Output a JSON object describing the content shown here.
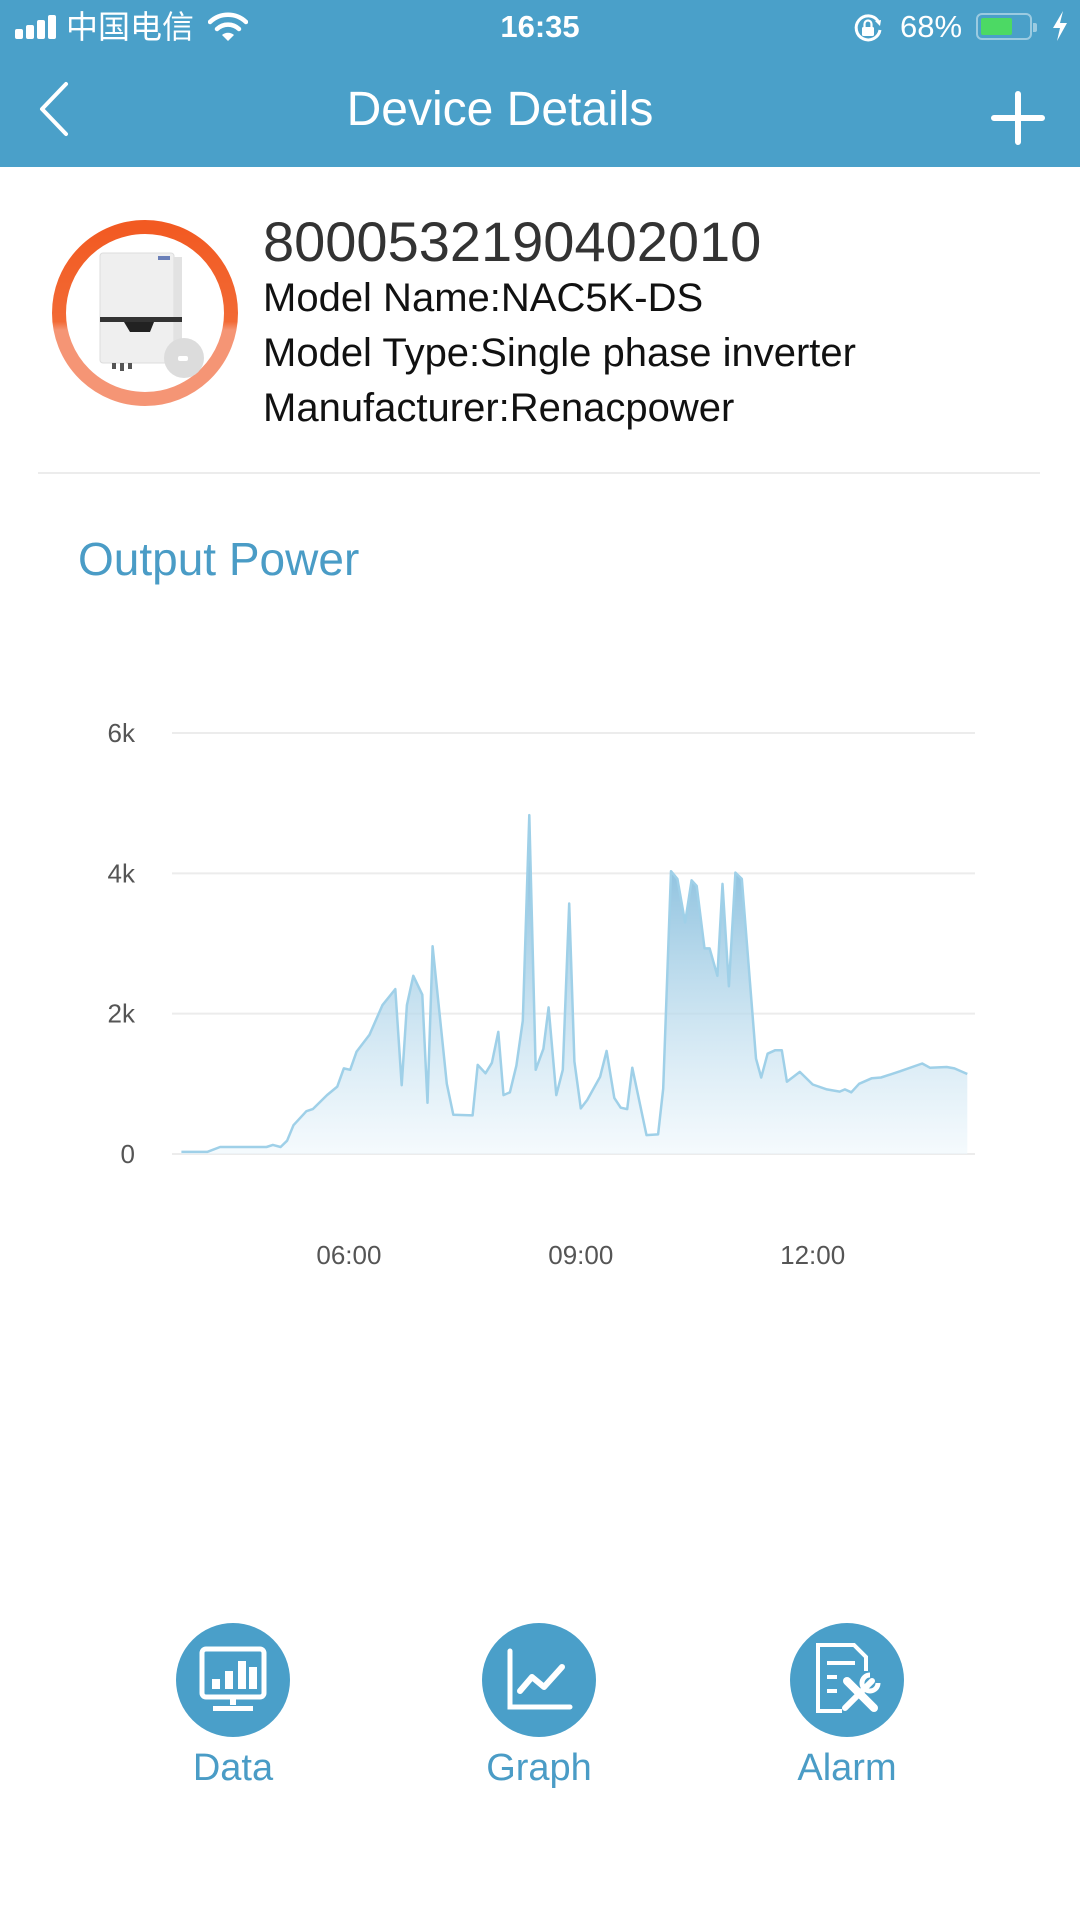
{
  "status_bar": {
    "carrier": "中国电信",
    "time": "16:35",
    "battery_percent_label": "68%",
    "battery_level": 0.68,
    "signal_bars": 4,
    "icons": [
      "signal-icon",
      "wifi-icon",
      "rotation-lock-icon",
      "battery-icon",
      "charging-bolt-icon"
    ]
  },
  "nav": {
    "title": "Device Details",
    "back_icon": "chevron-left-icon",
    "add_icon": "plus-icon"
  },
  "device": {
    "serial": "8000532190402010",
    "model_name": "Model Name:NAC5K-DS",
    "model_type": "Model Type:Single phase inverter",
    "manufacturer": "Manufacturer:Renacpower",
    "ring_colors": {
      "top": "#f25a22",
      "bottom": "#f59575"
    }
  },
  "section": {
    "title": "Output Power"
  },
  "colors": {
    "accent": "#4aa0c9",
    "line": "#9fd0e8",
    "fill_top": "#6fb1d6",
    "fill_bottom": "#eef7fc",
    "grid": "#ececec"
  },
  "chart_data": {
    "type": "area",
    "title": "Output Power",
    "xlabel": "",
    "ylabel": "",
    "xlim": [
      "03:45",
      "14:06"
    ],
    "ylim": [
      0,
      6000
    ],
    "yticks": [
      {
        "value": 0,
        "label": "0"
      },
      {
        "value": 2000,
        "label": "2k"
      },
      {
        "value": 4000,
        "label": "4k"
      },
      {
        "value": 6000,
        "label": "6k"
      }
    ],
    "xticks": [
      {
        "value": "06:00",
        "label": "06:00"
      },
      {
        "value": "09:00",
        "label": "09:00"
      },
      {
        "value": "12:00",
        "label": "12:00"
      }
    ],
    "grid": true,
    "legend": "none",
    "series": [
      {
        "name": "Output Power",
        "points": [
          [
            "03:50",
            30
          ],
          [
            "04:10",
            30
          ],
          [
            "04:20",
            100
          ],
          [
            "04:56",
            100
          ],
          [
            "05:01",
            130
          ],
          [
            "05:07",
            100
          ],
          [
            "05:12",
            190
          ],
          [
            "05:17",
            410
          ],
          [
            "05:27",
            610
          ],
          [
            "05:32",
            640
          ],
          [
            "05:43",
            840
          ],
          [
            "05:51",
            960
          ],
          [
            "05:56",
            1220
          ],
          [
            "06:01",
            1200
          ],
          [
            "06:06",
            1460
          ],
          [
            "06:16",
            1700
          ],
          [
            "06:26",
            2120
          ],
          [
            "06:36",
            2350
          ],
          [
            "06:41",
            980
          ],
          [
            "06:45",
            2120
          ],
          [
            "06:50",
            2540
          ],
          [
            "06:57",
            2270
          ],
          [
            "07:01",
            730
          ],
          [
            "07:05",
            2960
          ],
          [
            "07:16",
            1000
          ],
          [
            "07:21",
            560
          ],
          [
            "07:36",
            550
          ],
          [
            "07:40",
            1270
          ],
          [
            "07:46",
            1150
          ],
          [
            "07:51",
            1300
          ],
          [
            "07:56",
            1740
          ],
          [
            "08:00",
            840
          ],
          [
            "08:05",
            880
          ],
          [
            "08:10",
            1260
          ],
          [
            "08:15",
            1900
          ],
          [
            "08:20",
            4830
          ],
          [
            "08:25",
            1200
          ],
          [
            "08:31",
            1500
          ],
          [
            "08:35",
            2090
          ],
          [
            "08:41",
            840
          ],
          [
            "08:46",
            1200
          ],
          [
            "08:51",
            3570
          ],
          [
            "08:55",
            1320
          ],
          [
            "09:00",
            650
          ],
          [
            "09:05",
            770
          ],
          [
            "09:15",
            1100
          ],
          [
            "09:20",
            1470
          ],
          [
            "09:26",
            800
          ],
          [
            "09:31",
            660
          ],
          [
            "09:36",
            640
          ],
          [
            "09:40",
            1230
          ],
          [
            "09:51",
            270
          ],
          [
            "10:00",
            280
          ],
          [
            "10:04",
            930
          ],
          [
            "10:10",
            4030
          ],
          [
            "10:15",
            3920
          ],
          [
            "10:21",
            3300
          ],
          [
            "10:26",
            3900
          ],
          [
            "10:30",
            3820
          ],
          [
            "10:36",
            2930
          ],
          [
            "10:40",
            2930
          ],
          [
            "10:46",
            2540
          ],
          [
            "10:50",
            3850
          ],
          [
            "10:55",
            2390
          ],
          [
            "11:00",
            4010
          ],
          [
            "11:05",
            3920
          ],
          [
            "11:16",
            1360
          ],
          [
            "11:20",
            1090
          ],
          [
            "11:25",
            1430
          ],
          [
            "11:31",
            1480
          ],
          [
            "11:36",
            1480
          ],
          [
            "11:40",
            1030
          ],
          [
            "11:50",
            1170
          ],
          [
            "12:00",
            990
          ],
          [
            "12:11",
            920
          ],
          [
            "12:21",
            890
          ],
          [
            "12:25",
            920
          ],
          [
            "12:30",
            880
          ],
          [
            "12:36",
            1000
          ],
          [
            "12:46",
            1080
          ],
          [
            "12:53",
            1090
          ],
          [
            "13:08",
            1180
          ],
          [
            "13:25",
            1290
          ],
          [
            "13:31",
            1230
          ],
          [
            "13:44",
            1240
          ],
          [
            "13:50",
            1220
          ],
          [
            "14:00",
            1140
          ]
        ]
      }
    ]
  },
  "actions": [
    {
      "label": "Data",
      "icon": "monitor-bar-chart-icon"
    },
    {
      "label": "Graph",
      "icon": "line-graph-icon"
    },
    {
      "label": "Alarm",
      "icon": "document-tools-icon"
    }
  ]
}
